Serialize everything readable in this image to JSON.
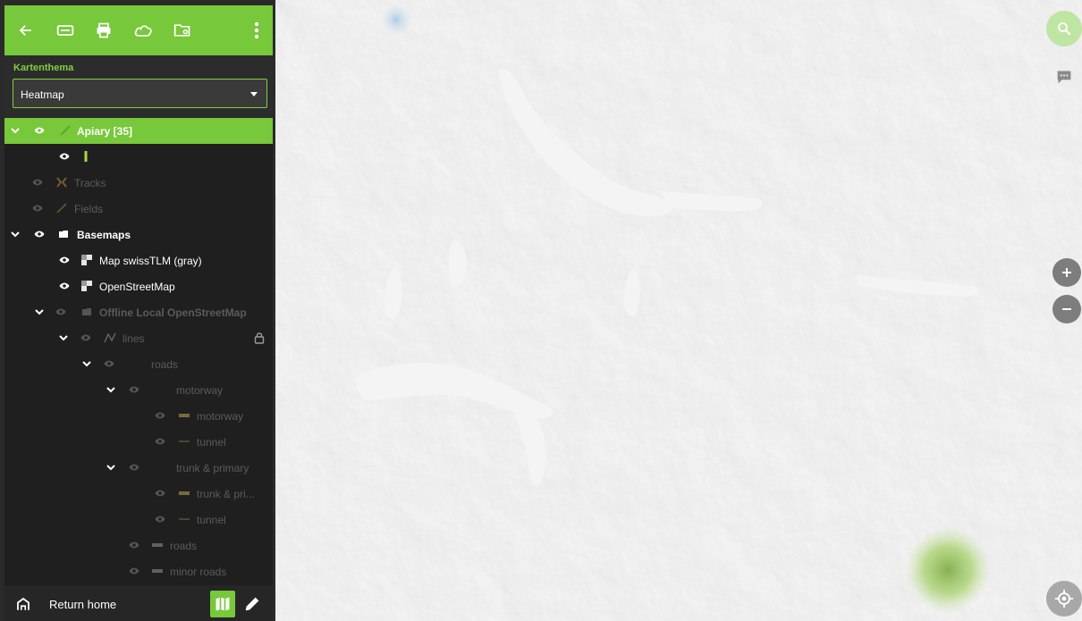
{
  "toolbar": {
    "icons": [
      "back-arrow-icon",
      "tag-icon",
      "print-icon",
      "cloud-icon",
      "folder-settings-icon",
      "more-vert-icon"
    ]
  },
  "theme": {
    "label": "Kartenthema",
    "selected": "Heatmap"
  },
  "layers": [
    {
      "label": "Apiary [35]",
      "icon": "line-icon",
      "state": "selected",
      "expanded": true
    },
    {
      "label": "",
      "icon": "marker-bar-icon",
      "state": "on"
    },
    {
      "label": "Tracks",
      "icon": "track-icon",
      "state": "off"
    },
    {
      "label": "Fields",
      "icon": "line-icon",
      "state": "off"
    },
    {
      "label": "Basemaps",
      "icon": "folder-icon",
      "state": "on",
      "expanded": true
    },
    {
      "label": "Map swissTLM (gray)",
      "icon": "tile-layer-icon",
      "state": "on"
    },
    {
      "label": "OpenStreetMap",
      "icon": "tile-layer-icon",
      "state": "on"
    },
    {
      "label": "Offline Local OpenStreetMap",
      "icon": "folder-icon",
      "state": "off",
      "expanded": true
    },
    {
      "label": "lines",
      "icon": "vector-line-icon",
      "state": "off",
      "expanded": true,
      "locked": true
    },
    {
      "label": "roads",
      "icon": "",
      "state": "off",
      "expanded": true
    },
    {
      "label": "motorway",
      "icon": "",
      "state": "off",
      "expanded": true
    },
    {
      "label": "motorway",
      "icon": "line-swatch-icon",
      "state": "off"
    },
    {
      "label": "tunnel",
      "icon": "line-swatch-icon",
      "state": "off"
    },
    {
      "label": "trunk & primary",
      "icon": "",
      "state": "off",
      "expanded": true
    },
    {
      "label": "trunk & pri...",
      "icon": "line-swatch-icon",
      "state": "off"
    },
    {
      "label": "tunnel",
      "icon": "line-swatch-icon",
      "state": "off"
    },
    {
      "label": "roads",
      "icon": "line-swatch-icon",
      "state": "off"
    },
    {
      "label": "minor roads",
      "icon": "line-swatch-icon",
      "state": "off"
    }
  ],
  "bottom": {
    "home_label": "Return home"
  },
  "map_controls": {
    "zoom_in": "+",
    "zoom_out": "−"
  },
  "colors": {
    "accent": "#77c83a",
    "sidebar": "#1f1f1f",
    "map_base": "#e9e9e9",
    "heat_blob": "#9ecc6a"
  }
}
